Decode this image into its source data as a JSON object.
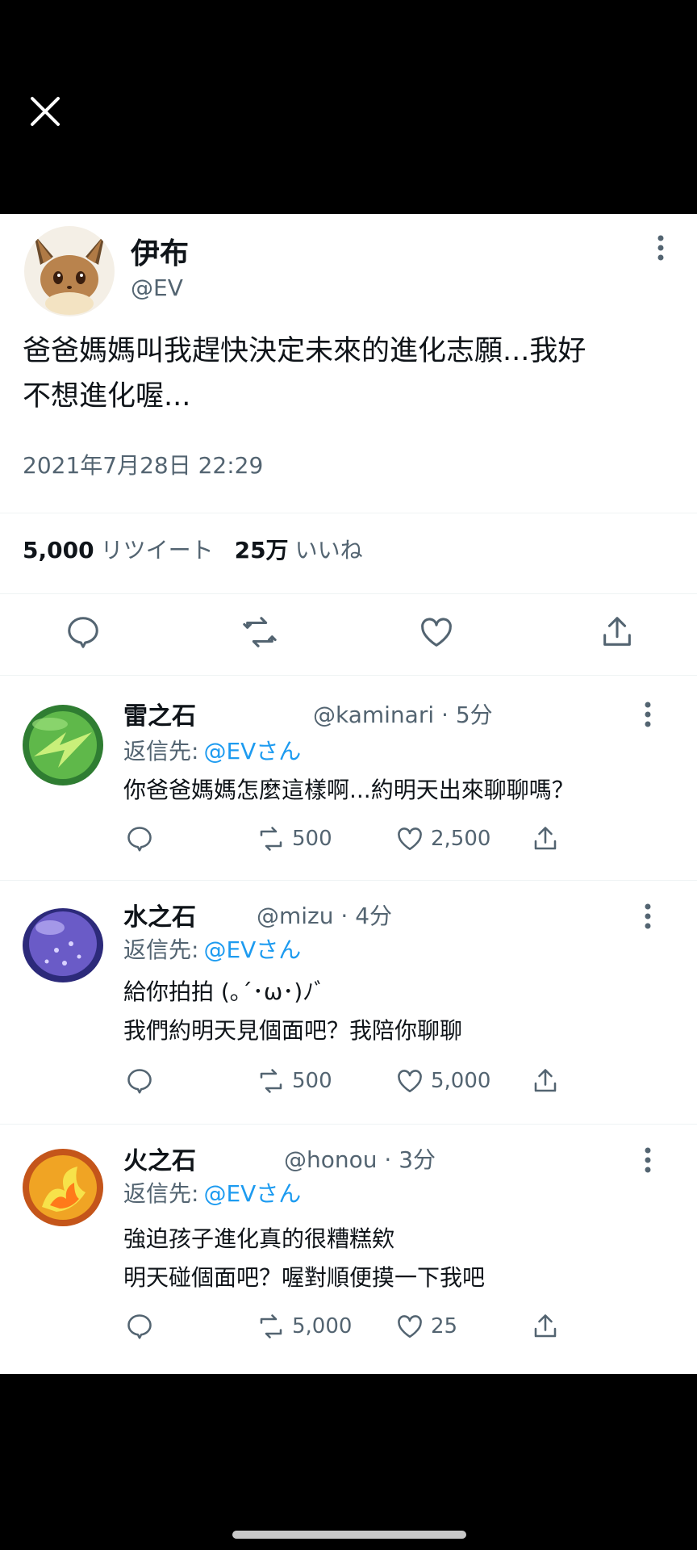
{
  "app": {
    "colors": {
      "accent": "#1d9bf0",
      "text": "#0f1419",
      "muted": "#536471",
      "background": "#ffffff",
      "letterbox": "#000000"
    },
    "close_icon": "close-icon"
  },
  "tweet": {
    "author_name": "伊布",
    "author_handle": "@EV",
    "text_line1": "爸爸媽媽叫我趕快決定未來的進化志願...我好",
    "text_line2": "不想進化喔...",
    "timestamp": "2021年7月28日 22:29",
    "retweet_count": "5,000",
    "retweet_label": "リツイート",
    "like_count": "25万",
    "like_label": "いいね",
    "actions": [
      "reply-icon",
      "retweet-icon",
      "like-icon",
      "share-icon"
    ]
  },
  "replies": [
    {
      "name": "雷之石",
      "handle_time": "@kaminari · 5分",
      "reply_to_label": "返信先:",
      "reply_to_mention": "@EVさん",
      "lines": [
        "你爸爸媽媽怎麼這樣啊...約明天出來聊聊嗎？"
      ],
      "retweets": "500",
      "likes": "2,500",
      "avatar_colors": [
        "#3a8f3a",
        "#8fd14f"
      ]
    },
    {
      "name": "水之石",
      "handle_time": "@mizu · 4分",
      "reply_to_label": "返信先:",
      "reply_to_mention": "@EVさん",
      "lines": [
        "給你拍拍 (｡´･ω･)ﾉﾞ",
        "我們約明天見個面吧？我陪你聊聊"
      ],
      "retweets": "500",
      "likes": "5,000",
      "avatar_colors": [
        "#3f3a9e",
        "#8d7ad8"
      ]
    },
    {
      "name": "火之石",
      "handle_time": "@honou · 3分",
      "reply_to_label": "返信先:",
      "reply_to_mention": "@EVさん",
      "lines": [
        "強迫孩子進化真的很糟糕欸",
        "明天碰個面吧？喔對順便摸一下我吧"
      ],
      "retweets": "5,000",
      "likes": "25",
      "avatar_colors": [
        "#e07a1a",
        "#f3d23a"
      ]
    }
  ]
}
